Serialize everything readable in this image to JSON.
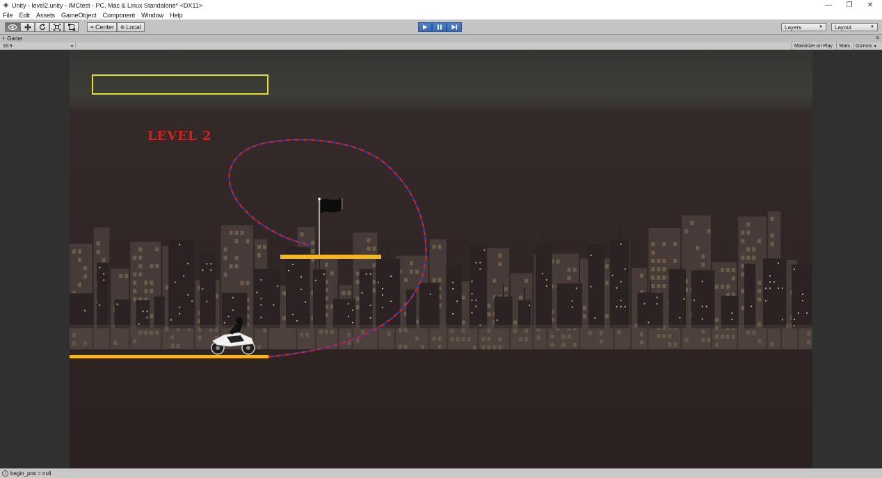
{
  "window": {
    "title": "Unity - level2.unity - IMCtest - PC, Mac & Linux Standalone* <DX11>",
    "minimize_glyph": "—",
    "restore_glyph": "❐",
    "close_glyph": "✕"
  },
  "menu": [
    "File",
    "Edit",
    "Assets",
    "GameObject",
    "Component",
    "Window",
    "Help"
  ],
  "toolbar": {
    "tools": [
      "hand-tool",
      "move-tool",
      "rotate-tool",
      "scale-tool",
      "rect-tool"
    ],
    "pivot_label": "Center",
    "space_label": "Local",
    "playback": [
      "play",
      "pause",
      "step"
    ],
    "layers_label": "Layers",
    "layout_label": "Layout"
  },
  "game_tab": {
    "label": "Game",
    "aspect": "16:9",
    "maximize_label": "Maximize on Play",
    "stats_label": "Stats",
    "gizmos_label": "Gizmos"
  },
  "game": {
    "level_text": "LEVEL 2",
    "score_box_color": "#e5e02a",
    "platform_color": "#f5b623",
    "path_colors": [
      "#d42020",
      "#2a3fb0"
    ]
  },
  "status": {
    "message": "begin_pos = null"
  }
}
